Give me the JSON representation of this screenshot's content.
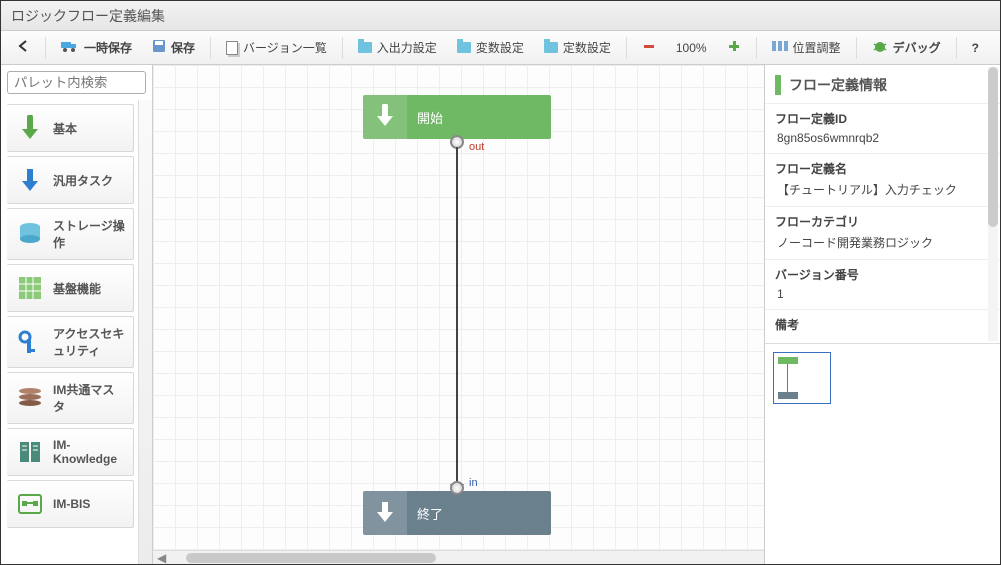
{
  "header": {
    "title": "ロジックフロー定義編集"
  },
  "toolbar": {
    "temp_save": "一時保存",
    "save": "保存",
    "version_list": "バージョン一覧",
    "io_settings": "入出力設定",
    "var_settings": "変数設定",
    "const_settings": "定数設定",
    "zoom": "100%",
    "align": "位置調整",
    "debug": "デバッグ",
    "help": "?"
  },
  "palette": {
    "search_placeholder": "パレット内検索",
    "items": [
      {
        "label": "基本"
      },
      {
        "label": "汎用タスク"
      },
      {
        "label": "ストレージ操作"
      },
      {
        "label": "基盤機能"
      },
      {
        "label": "アクセスセキュリティ"
      },
      {
        "label": "IM共通マスタ"
      },
      {
        "label": "IM-Knowledge"
      },
      {
        "label": "IM-BIS"
      }
    ]
  },
  "canvas": {
    "start_label": "開始",
    "end_label": "終了",
    "out_label": "out",
    "in_label": "in"
  },
  "info": {
    "panel_title": "フロー定義情報",
    "fields": {
      "id_label": "フロー定義ID",
      "id_value": "8gn85os6wmnrqb2",
      "name_label": "フロー定義名",
      "name_value": "【チュートリアル】入力チェック",
      "category_label": "フローカテゴリ",
      "category_value": "ノーコード開発業務ロジック",
      "version_label": "バージョン番号",
      "version_value": "1",
      "note_label": "備考"
    }
  }
}
